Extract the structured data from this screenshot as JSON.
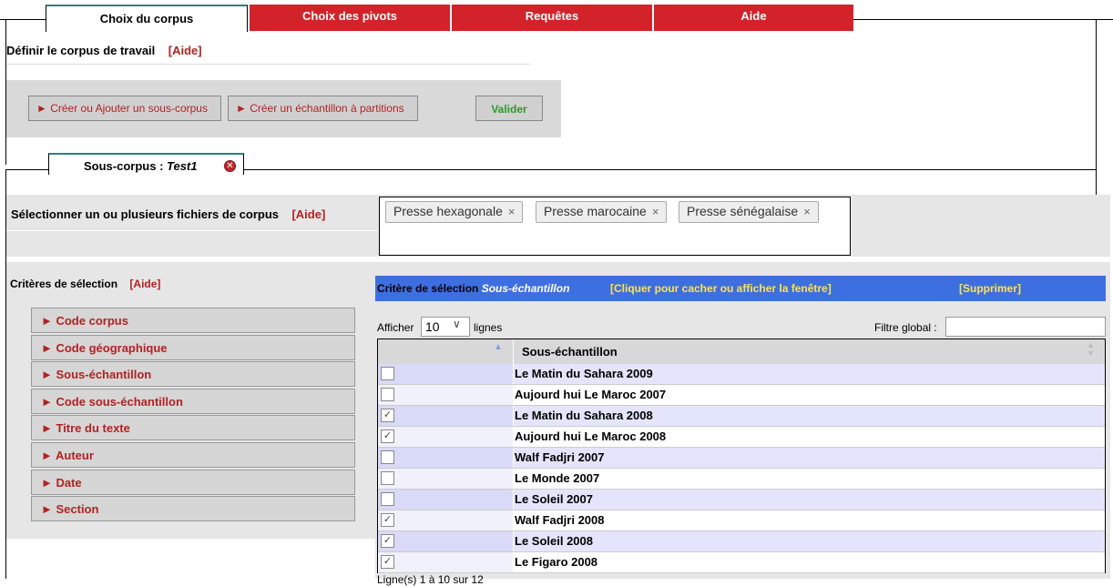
{
  "tabs": {
    "corpus": "Choix du corpus",
    "pivots": "Choix des pivots",
    "requetes": "Requêtes",
    "aide": "Aide"
  },
  "header": {
    "title": "Définir le corpus de travail",
    "aide": "[Aide]"
  },
  "toolbar": {
    "create_subcorpus": "► Créer ou Ajouter un sous-corpus",
    "create_sample": "► Créer un échantillon à partitions",
    "validate": "Valider"
  },
  "subtab": {
    "prefix": "Sous-corpus : ",
    "name": "Test1",
    "close": "✕"
  },
  "files": {
    "label": "Sélectionner un ou plusieurs fichiers de corpus",
    "aide": "[Aide]",
    "chips": [
      "Presse hexagonale",
      "Presse marocaine",
      "Presse sénégalaise"
    ],
    "chip_close": "×"
  },
  "criteria": {
    "label": "Critères de sélection",
    "aide": "[Aide]",
    "items": [
      "► Code corpus",
      "► Code géographique",
      "► Sous-échantillon",
      "► Code sous-échantillon",
      "► Titre du texte",
      "► Auteur",
      "► Date",
      "► Section"
    ]
  },
  "panel": {
    "title_prefix": "Critère de sélection ",
    "title_name": "Sous-échantillon",
    "toggle": "[Cliquer pour cacher ou afficher la fenêtre]",
    "delete": "[Supprimer]",
    "show_prefix": "Afficher",
    "show_value": "10",
    "show_suffix": "lignes",
    "filter_label": "Filtre global :",
    "filter_value": "",
    "column": "Sous-échantillon",
    "footer": "Ligne(s) 1 à 10 sur 12"
  },
  "rows": [
    {
      "label": "Le Matin du Sahara 2009",
      "checked": false
    },
    {
      "label": "Aujourd hui Le Maroc 2007",
      "checked": false
    },
    {
      "label": "Le Matin du Sahara 2008",
      "checked": true
    },
    {
      "label": "Aujourd hui Le Maroc 2008",
      "checked": true
    },
    {
      "label": "Walf Fadjri 2007",
      "checked": false
    },
    {
      "label": "Le Monde 2007",
      "checked": false
    },
    {
      "label": "Le Soleil 2007",
      "checked": false
    },
    {
      "label": "Walf Fadjri 2008",
      "checked": true
    },
    {
      "label": "Le Soleil 2008",
      "checked": true
    },
    {
      "label": "Le Figaro 2008",
      "checked": true
    }
  ]
}
